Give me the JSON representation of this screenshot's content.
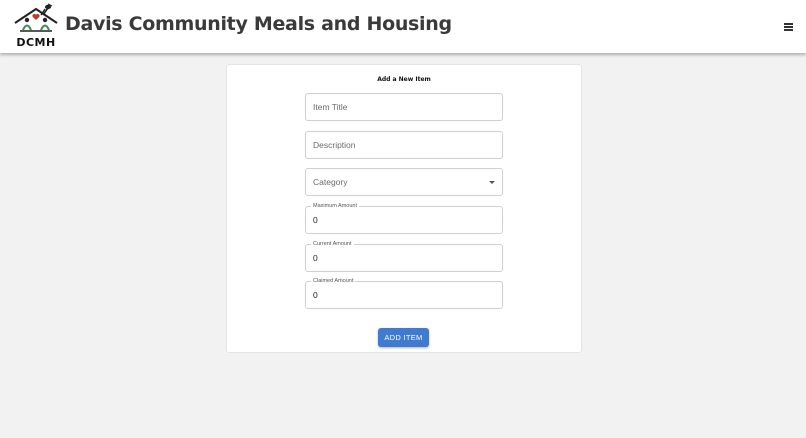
{
  "header": {
    "logo_text": "DCMH",
    "title": "Davis Community Meals and Housing",
    "menu_icon": "hamburger-menu-icon"
  },
  "form": {
    "title": "Add a New Item",
    "item_title": {
      "value": "",
      "placeholder": "Item Title"
    },
    "description": {
      "value": "",
      "placeholder": "Description"
    },
    "category": {
      "label": "Category",
      "icon": "chevron-down-icon"
    },
    "maximum_amount": {
      "label": "Maximum Amount",
      "value": "0"
    },
    "current_amount": {
      "label": "Current Amount",
      "value": "0"
    },
    "claimed_amount": {
      "label": "Claimed Amount",
      "value": "0"
    },
    "submit_label": "ADD ITEM"
  },
  "colors": {
    "accent": "#3f7bd1",
    "background": "#f2f2f2",
    "logo_heart": "#c0392b",
    "logo_house": "#3f8a4f"
  }
}
